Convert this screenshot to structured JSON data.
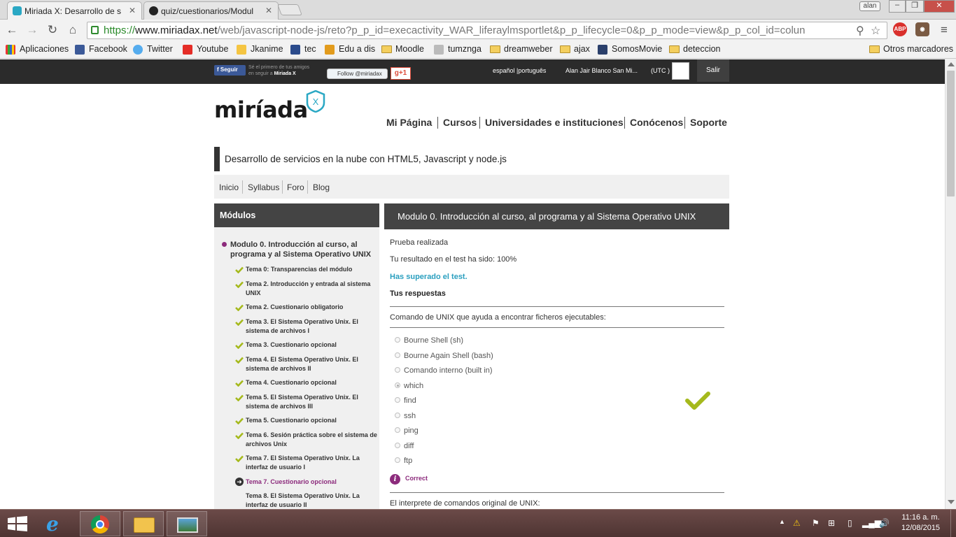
{
  "browser": {
    "tabs": [
      {
        "title": "Miriada X: Desarrollo de s",
        "active": true
      },
      {
        "title": "quiz/cuestionarios/Modul",
        "active": false
      }
    ],
    "profile": "alan",
    "url": {
      "scheme": "https://",
      "host": "www.miriadax.net",
      "path": "/web/javascript-node-js/reto?p_p_id=execactivity_WAR_liferaylmsportlet&p_p_lifecycle=0&p_p_mode=view&p_p_col_id=colun"
    },
    "extension_abp": "ABP",
    "bookmarks": [
      "Aplicaciones",
      "Facebook",
      "Twitter",
      "Youtube",
      "Jkanime",
      "tec",
      "Edu a dis",
      "Moodle",
      "tumznga",
      "dreamweber",
      "ajax",
      "SomosMovie",
      "deteccion"
    ],
    "other_bookmarks": "Otros marcadores"
  },
  "topbar": {
    "fb_label": "Seguir",
    "social_note_line1": "Sé el primero de tus amigos",
    "social_note_prefix": "en seguir a ",
    "social_note_brand": "Miriada X",
    "twitter_label": "Follow @miriadax",
    "gplus_label": "g+1",
    "lang_es": "español",
    "lang_pt": "português",
    "user_name": "Alan Jair Blanco San Mi...",
    "timezone": "(UTC )",
    "logout": "Salir"
  },
  "site": {
    "logo": "miríada",
    "logo_mark": "X",
    "nav": [
      "Mi Página",
      "Cursos",
      "Universidades e instituciones",
      "Conócenos",
      "Soporte"
    ],
    "course_title": "Desarrollo de servicios en la nube con HTML5, Javascript y node.js",
    "subnav": [
      "Inicio",
      "Syllabus",
      "Foro",
      "Blog"
    ]
  },
  "sidebar": {
    "heading": "Módulos",
    "module_title": "Modulo 0. Introducción al curso, al programa y al Sistema Operativo UNIX",
    "topics": [
      {
        "label": "Tema 0: Transparencias del módulo",
        "status": "done"
      },
      {
        "label": "Tema 2. Introducción y entrada al sistema UNIX",
        "status": "done"
      },
      {
        "label": "Tema 2. Cuestionario obligatorio",
        "status": "done"
      },
      {
        "label": "Tema 3. El Sistema Operativo Unix. El sistema de archivos I",
        "status": "done"
      },
      {
        "label": "Tema 3. Cuestionario opcional",
        "status": "done"
      },
      {
        "label": "Tema 4. El Sistema Operativo Unix. El sistema de archivos II",
        "status": "done"
      },
      {
        "label": "Tema 4. Cuestionario opcional",
        "status": "done"
      },
      {
        "label": "Tema 5. El Sistema Operativo Unix. El sistema de archivos III",
        "status": "done"
      },
      {
        "label": "Tema 5. Cuestionario opcional",
        "status": "done"
      },
      {
        "label": "Tema 6. Sesión práctica sobre el sistema de archivos Unix",
        "status": "done"
      },
      {
        "label": "Tema 7. El Sistema Operativo Unix. La interfaz de usuario I",
        "status": "done"
      },
      {
        "label": "Tema 7. Cuestionario opcional",
        "status": "current"
      },
      {
        "label": "Tema 8. El Sistema Operativo Unix. La interfaz de usuario II",
        "status": "pending"
      }
    ]
  },
  "content": {
    "heading": "Modulo 0. Introducción al curso, al programa y al Sistema Operativo UNIX",
    "status_line": "Prueba realizada",
    "score_line": "Tu resultado en el test ha sido: 100%",
    "passed": "Has superado el test.",
    "answers_heading": "Tus respuestas",
    "question1": "Comando de UNIX que ayuda a encontrar ficheros ejecutables:",
    "options": [
      "Bourne Shell (sh)",
      "Bourne Again Shell (bash)",
      "Comando interno (built in)",
      "which",
      "find",
      "ssh",
      "ping",
      "diff",
      "ftp"
    ],
    "selected_option": "which",
    "feedback": "Correct",
    "question2": "El interprete de comandos original de UNIX:"
  },
  "taskbar": {
    "time": "11:16 a. m.",
    "date": "12/08/2015"
  },
  "colors": {
    "accent_purple": "#8c2b7c",
    "check_green": "#a5b91c",
    "link_blue": "#2a9fbf",
    "brand_teal": "#2aa8c4"
  }
}
